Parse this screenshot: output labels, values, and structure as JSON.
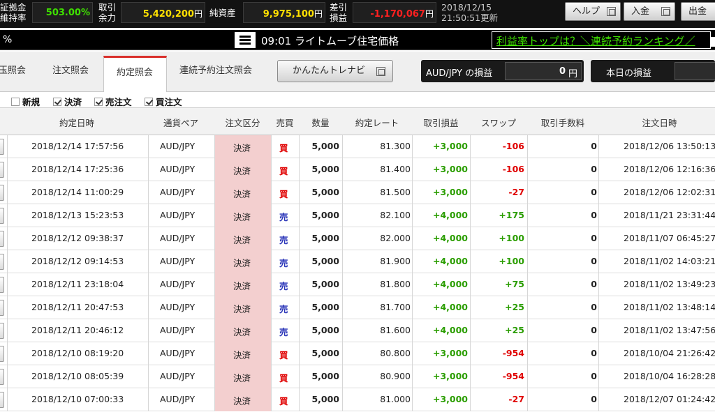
{
  "topbar": {
    "margin_label_1": "証拠金",
    "margin_label_2": "維持率",
    "margin_value": "503.00%",
    "trade_label_1": "取引",
    "trade_label_2": "余力",
    "trade_value": "5,420,200",
    "yen": "円",
    "net_assets_label": "純資産",
    "net_assets_value": "9,975,100",
    "diff_label_1": "差引",
    "diff_label_2": "損益",
    "diff_value": "-1,170,067",
    "date": "2018/12/15",
    "updated": "21:50:51更新",
    "help_button": "ヘルプ",
    "deposit_button": "入金",
    "withdraw_button": "出金",
    "colors": {
      "green": "#3fe000",
      "yellow": "#ffe000",
      "red": "#ff2020"
    }
  },
  "news": {
    "pct_fragment": "%",
    "time": "09:01",
    "headline": "ライトムーブ住宅価格",
    "link_text": "利益率トップは？＼連続予約ランキング／"
  },
  "tabs": {
    "items": [
      "玉照会",
      "注文照会",
      "約定照会",
      "連続予約注文照会"
    ],
    "active": "約定照会",
    "trenavi_button": "かんたんトレナビ",
    "pair_pl_label": "AUD/JPY の損益",
    "pair_pl_value": "0",
    "pair_pl_unit": "円",
    "today_pl_label": "本日の損益"
  },
  "filters": [
    {
      "label": "新規",
      "checked": false
    },
    {
      "label": "決済",
      "checked": true
    },
    {
      "label": "売注文",
      "checked": true
    },
    {
      "label": "買注文",
      "checked": true
    }
  ],
  "table": {
    "headers": [
      "約定日時",
      "通貨ペア",
      "注文区分",
      "売買",
      "数量",
      "約定レート",
      "取引損益",
      "スワップ",
      "取引手数料",
      "注文日時"
    ],
    "rows": [
      {
        "date": "2018/12/14 17:57:56",
        "pair": "AUD/JPY",
        "kubun": "決済",
        "bs": "買",
        "qty": "5,000",
        "rate": "81.300",
        "pl": "+3,000",
        "swap": "-106",
        "fee": "0",
        "order_date": "2018/12/06 13:50:13"
      },
      {
        "date": "2018/12/14 17:25:36",
        "pair": "AUD/JPY",
        "kubun": "決済",
        "bs": "買",
        "qty": "5,000",
        "rate": "81.400",
        "pl": "+3,000",
        "swap": "-106",
        "fee": "0",
        "order_date": "2018/12/06 12:16:36"
      },
      {
        "date": "2018/12/14 11:00:29",
        "pair": "AUD/JPY",
        "kubun": "決済",
        "bs": "買",
        "qty": "5,000",
        "rate": "81.500",
        "pl": "+3,000",
        "swap": "-27",
        "fee": "0",
        "order_date": "2018/12/06 12:02:31"
      },
      {
        "date": "2018/12/13 15:23:53",
        "pair": "AUD/JPY",
        "kubun": "決済",
        "bs": "売",
        "qty": "5,000",
        "rate": "82.100",
        "pl": "+4,000",
        "swap": "+175",
        "fee": "0",
        "order_date": "2018/11/21 23:31:44"
      },
      {
        "date": "2018/12/12 09:38:37",
        "pair": "AUD/JPY",
        "kubun": "決済",
        "bs": "売",
        "qty": "5,000",
        "rate": "82.000",
        "pl": "+4,000",
        "swap": "+100",
        "fee": "0",
        "order_date": "2018/11/07 06:45:27"
      },
      {
        "date": "2018/12/12 09:14:53",
        "pair": "AUD/JPY",
        "kubun": "決済",
        "bs": "売",
        "qty": "5,000",
        "rate": "81.900",
        "pl": "+4,000",
        "swap": "+100",
        "fee": "0",
        "order_date": "2018/11/02 14:03:21"
      },
      {
        "date": "2018/12/11 23:18:04",
        "pair": "AUD/JPY",
        "kubun": "決済",
        "bs": "売",
        "qty": "5,000",
        "rate": "81.800",
        "pl": "+4,000",
        "swap": "+75",
        "fee": "0",
        "order_date": "2018/11/02 13:49:23"
      },
      {
        "date": "2018/12/11 20:47:53",
        "pair": "AUD/JPY",
        "kubun": "決済",
        "bs": "売",
        "qty": "5,000",
        "rate": "81.700",
        "pl": "+4,000",
        "swap": "+25",
        "fee": "0",
        "order_date": "2018/11/02 13:48:14"
      },
      {
        "date": "2018/12/11 20:46:12",
        "pair": "AUD/JPY",
        "kubun": "決済",
        "bs": "売",
        "qty": "5,000",
        "rate": "81.600",
        "pl": "+4,000",
        "swap": "+25",
        "fee": "0",
        "order_date": "2018/11/02 13:47:56"
      },
      {
        "date": "2018/12/10 08:19:20",
        "pair": "AUD/JPY",
        "kubun": "決済",
        "bs": "買",
        "qty": "5,000",
        "rate": "80.800",
        "pl": "+3,000",
        "swap": "-954",
        "fee": "0",
        "order_date": "2018/10/04 21:26:42"
      },
      {
        "date": "2018/12/10 08:05:39",
        "pair": "AUD/JPY",
        "kubun": "決済",
        "bs": "買",
        "qty": "5,000",
        "rate": "80.900",
        "pl": "+3,000",
        "swap": "-954",
        "fee": "0",
        "order_date": "2018/10/04 16:28:28"
      },
      {
        "date": "2018/12/10 07:00:33",
        "pair": "AUD/JPY",
        "kubun": "決済",
        "bs": "買",
        "qty": "5,000",
        "rate": "81.000",
        "pl": "+3,000",
        "swap": "-27",
        "fee": "0",
        "order_date": "2018/12/07 01:24:42"
      }
    ]
  }
}
